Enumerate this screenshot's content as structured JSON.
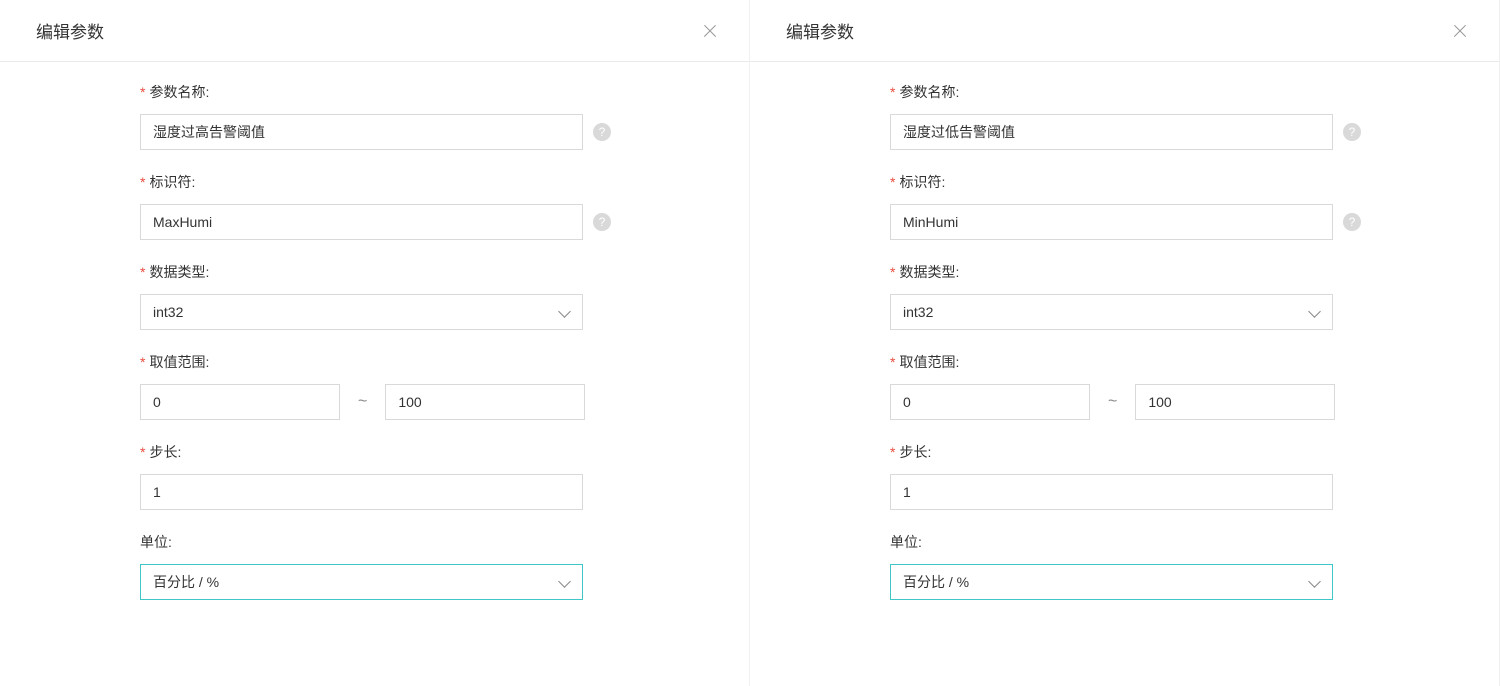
{
  "left": {
    "title": "编辑参数",
    "fields": {
      "paramName": {
        "label": "参数名称:",
        "value": "湿度过高告警阈值"
      },
      "identifier": {
        "label": "标识符:",
        "value": "MaxHumi"
      },
      "dataType": {
        "label": "数据类型:",
        "value": "int32"
      },
      "range": {
        "label": "取值范围:",
        "min": "0",
        "max": "100",
        "sep": "~"
      },
      "step": {
        "label": "步长:",
        "value": "1"
      },
      "unit": {
        "label": "单位:",
        "value": "百分比 / %"
      }
    }
  },
  "right": {
    "title": "编辑参数",
    "fields": {
      "paramName": {
        "label": "参数名称:",
        "value": "湿度过低告警阈值"
      },
      "identifier": {
        "label": "标识符:",
        "value": "MinHumi"
      },
      "dataType": {
        "label": "数据类型:",
        "value": "int32"
      },
      "range": {
        "label": "取值范围:",
        "min": "0",
        "max": "100",
        "sep": "~"
      },
      "step": {
        "label": "步长:",
        "value": "1"
      },
      "unit": {
        "label": "单位:",
        "value": "百分比 / %"
      }
    }
  },
  "asterisk": "*",
  "helpGlyph": "?"
}
